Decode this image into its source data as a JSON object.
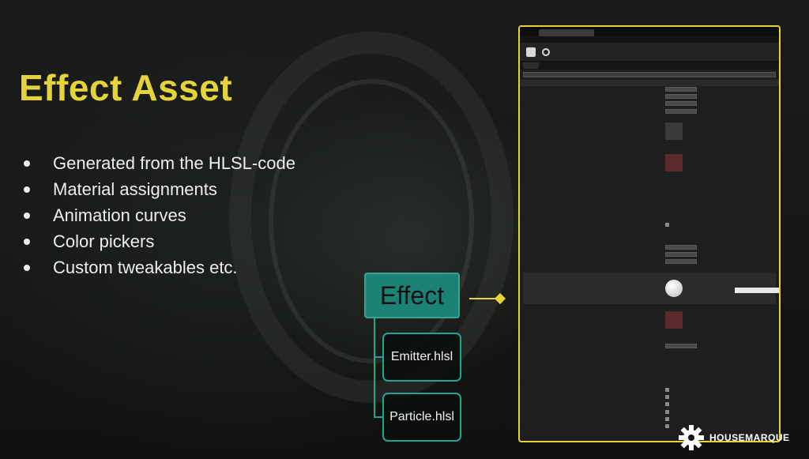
{
  "slide": {
    "title": "Effect Asset",
    "bullets": [
      "Generated from the HLSL-code",
      "Material assignments",
      "Animation curves",
      "Color pickers",
      "Custom tweakables etc."
    ]
  },
  "diagram": {
    "root": "Effect",
    "children": [
      "Emitter.hlsl",
      "Particle.hlsl"
    ]
  },
  "logo": {
    "text": "HOUSEMARQUE"
  },
  "colors": {
    "title": "#e4d33a",
    "node_fill": "#1d8276",
    "node_border": "#22a58e"
  }
}
